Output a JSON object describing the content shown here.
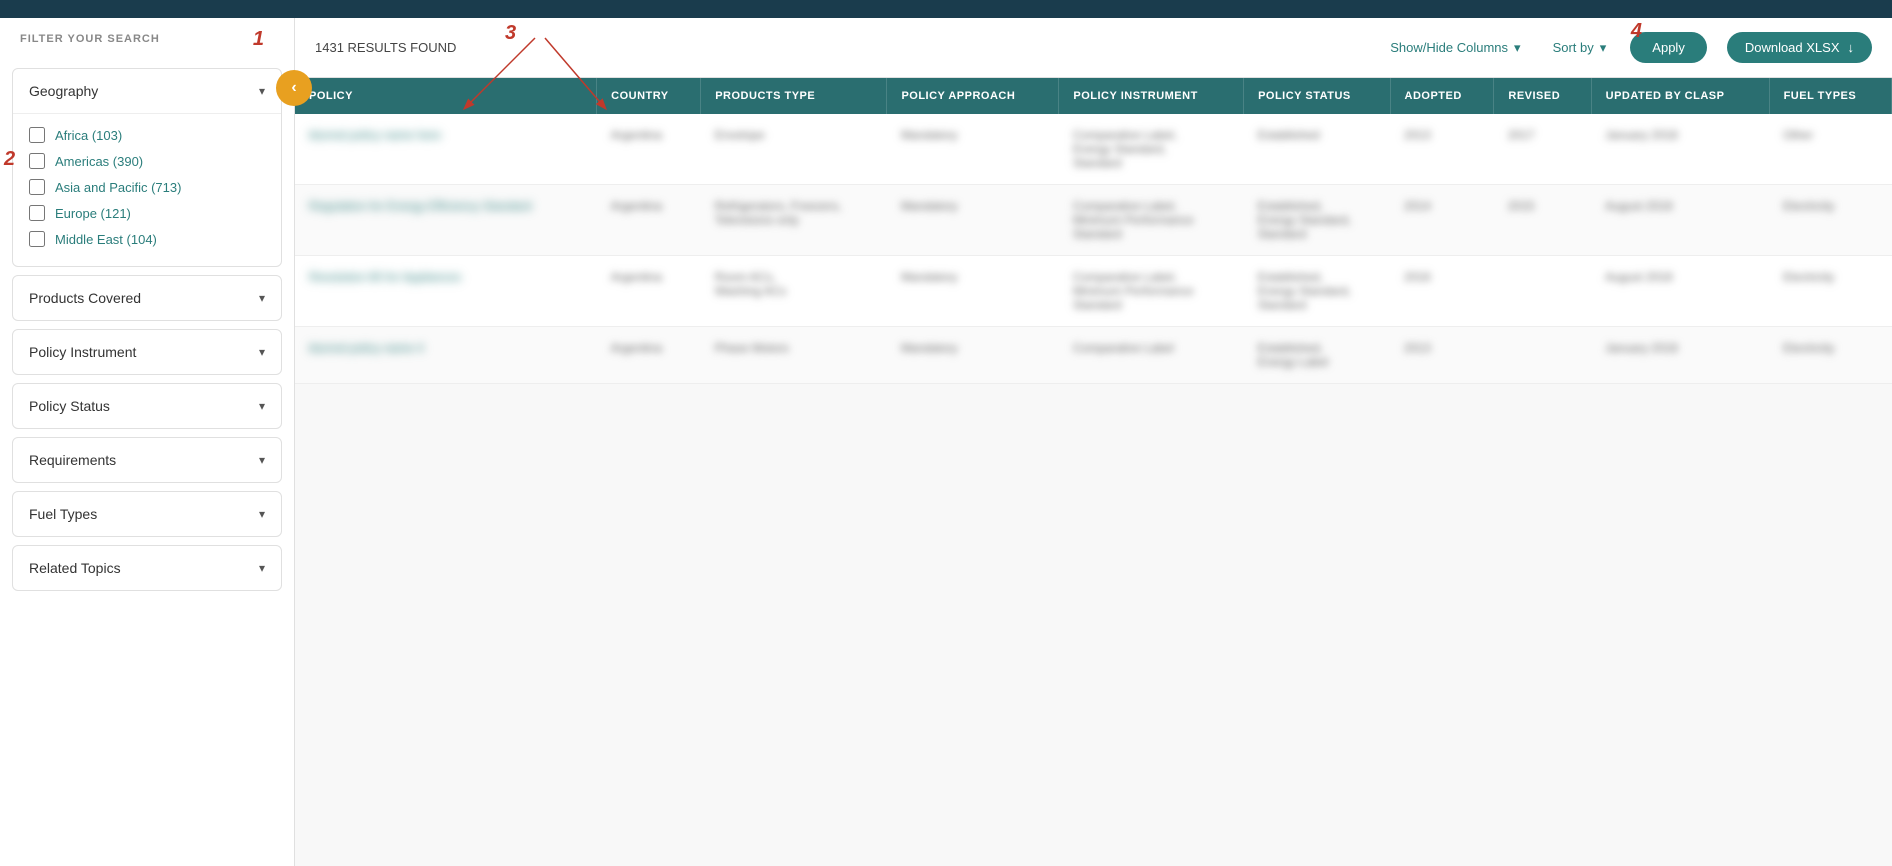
{
  "topBar": {},
  "sidebar": {
    "filterHeader": "FILTER YOUR SEARCH",
    "collapseIcon": "‹",
    "sections": [
      {
        "id": "geography",
        "label": "Geography",
        "expanded": true,
        "options": [
          {
            "id": "africa",
            "label": "Africa (103)",
            "checked": false
          },
          {
            "id": "americas",
            "label": "Americas (390)",
            "checked": false
          },
          {
            "id": "asia",
            "label": "Asia and Pacific (713)",
            "checked": false
          },
          {
            "id": "europe",
            "label": "Europe (121)",
            "checked": false
          },
          {
            "id": "middleeast",
            "label": "Middle East (104)",
            "checked": false
          }
        ]
      },
      {
        "id": "products-covered",
        "label": "Products Covered",
        "expanded": false
      },
      {
        "id": "policy-instrument",
        "label": "Policy Instrument",
        "expanded": false
      },
      {
        "id": "policy-status",
        "label": "Policy Status",
        "expanded": false
      },
      {
        "id": "requirements",
        "label": "Requirements",
        "expanded": false
      },
      {
        "id": "fuel-types",
        "label": "Fuel Types",
        "expanded": false
      },
      {
        "id": "related-topics",
        "label": "Related Topics",
        "expanded": false
      }
    ]
  },
  "toolbar": {
    "resultsCount": "1431 RESULTS FOUND",
    "showHideLabel": "Show/Hide Columns",
    "sortByLabel": "Sort by",
    "applyLabel": "Apply",
    "downloadLabel": "Download XLSX",
    "downloadIcon": "↓"
  },
  "table": {
    "columns": [
      "POLICY",
      "COUNTRY",
      "PRODUCTS TYPE",
      "POLICY APPROACH",
      "POLICY INSTRUMENT",
      "POLICY STATUS",
      "ADOPTED",
      "REVISED",
      "UPDATED BY CLASP",
      "FUEL TYPES"
    ],
    "rows": [
      {
        "policy": "blurred policy 1",
        "country": "Argentina",
        "productsType": "Envelope",
        "policyApproach": "Mandatory",
        "policyInstrument": "Comparative Label, Energy Standard, Standard",
        "policyStatus": "blurred",
        "adopted": "2013",
        "revised": "2017",
        "updatedByClasp": "January 2018",
        "fuelTypes": "Other"
      },
      {
        "policy": "Regulation for Energy Efficiency",
        "country": "Argentina",
        "productsType": "Refrigerators, Freezers, Televisions only",
        "policyApproach": "Mandatory",
        "policyInstrument": "Comparative Label, Minimum Performance Standard",
        "policyStatus": "Established, Energy Standard, Standard",
        "adopted": "2014",
        "revised": "2015",
        "updatedByClasp": "August 2018",
        "fuelTypes": "Electricity"
      },
      {
        "policy": "Resolution 80 for Appliances",
        "country": "Argentina",
        "productsType": "Room ACs, Washing ACs",
        "policyApproach": "Mandatory",
        "policyInstrument": "Comparative Label, Minimum Performance Standard",
        "policyStatus": "Established, Energy Standard, Standard",
        "adopted": "2016",
        "revised": "",
        "updatedByClasp": "August 2018",
        "fuelTypes": "Electricity"
      },
      {
        "policy": "blurred policy 4",
        "country": "Argentina",
        "productsType": "Phase Motors",
        "policyApproach": "Mandatory",
        "policyInstrument": "Comparative Label",
        "policyStatus": "Established, Energy Label",
        "adopted": "2013",
        "revised": "",
        "updatedByClasp": "January 2018",
        "fuelTypes": "Electricity"
      }
    ]
  },
  "annotations": {
    "num1": "1",
    "num2": "2",
    "num3": "3",
    "num4": "4"
  }
}
